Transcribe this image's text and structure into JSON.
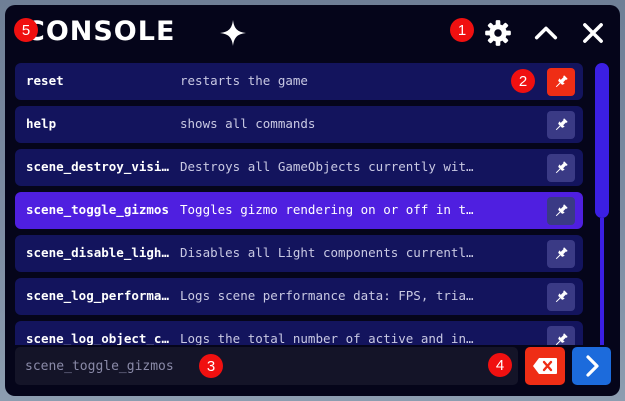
{
  "app": {
    "title": "CONSOLE"
  },
  "commands": [
    {
      "name": "reset",
      "description": "restarts the game",
      "pinned": true,
      "active": false
    },
    {
      "name": "help",
      "description": "shows all commands",
      "pinned": false,
      "active": false
    },
    {
      "name": "scene_destroy_visi…",
      "description": "Destroys all GameObjects currently wit…",
      "pinned": false,
      "active": false
    },
    {
      "name": "scene_toggle_gizmos",
      "description": "Toggles gizmo rendering on or off in t…",
      "pinned": false,
      "active": true
    },
    {
      "name": "scene_disable_ligh…",
      "description": "Disables all Light components currentl…",
      "pinned": false,
      "active": false
    },
    {
      "name": "scene_log_performa…",
      "description": "Logs scene performance data: FPS, tria…",
      "pinned": false,
      "active": false
    },
    {
      "name": "scene_log_object_c…",
      "description": "Logs the total number of active and in…",
      "pinned": false,
      "active": false
    }
  ],
  "input": {
    "value": "",
    "placeholder": "scene_toggle_gizmos"
  },
  "markers": [
    "1",
    "2",
    "3",
    "4",
    "5"
  ],
  "icons": {
    "settings": "gear-icon",
    "collapse": "chevron-up-icon",
    "close": "close-icon",
    "pin": "pin-icon",
    "clear": "backspace-icon",
    "send": "chevron-right-icon",
    "logo": "sparkle-icon"
  },
  "colors": {
    "window_bg": "#05051a",
    "row_bg": "#13145d",
    "row_active": "#4f1fe0",
    "pin_off": "#3a3a85",
    "pin_on": "#ef2d15",
    "clear_button": "#ef2d15",
    "send_button": "#1c6bdc",
    "scrollbar": "#3b1fe3",
    "marker": "#f01010"
  }
}
